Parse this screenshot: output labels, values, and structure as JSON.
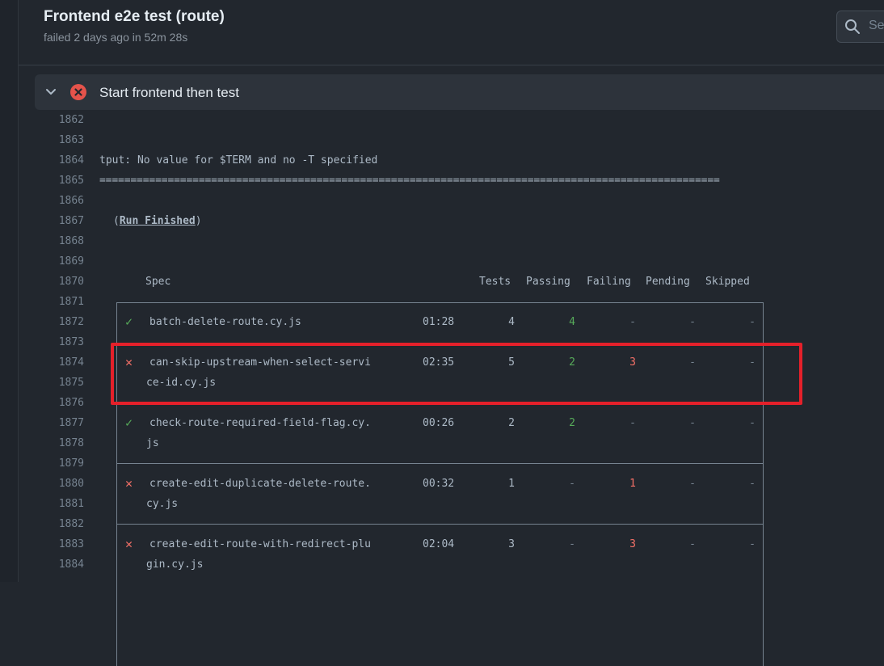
{
  "header": {
    "title": "Frontend e2e test (route)",
    "subtitle": "failed 2 days ago in 52m 28s",
    "search_placeholder": "Se"
  },
  "step": {
    "title": "Start frontend then test"
  },
  "log": {
    "line_numbers": [
      "1862",
      "1863",
      "1864",
      "1865",
      "1866",
      "1867",
      "1868",
      "1869",
      "1870",
      "1871",
      "1872",
      "1873",
      "1874",
      "1875",
      "1876",
      "1877",
      "1878",
      "1879",
      "1880",
      "1881",
      "1882",
      "1883",
      "1884"
    ],
    "tput_line": "tput: No value for $TERM and no -T specified",
    "separator": "====================================================================================================",
    "run_finished_open": "(",
    "run_finished": "Run Finished",
    "run_finished_close": ")",
    "headers": {
      "spec": "Spec",
      "tests": "Tests",
      "passing": "Passing",
      "failing": "Failing",
      "pending": "Pending",
      "skipped": "Skipped"
    },
    "rows": [
      {
        "status": "pass",
        "mark": "✓",
        "name1": "batch-delete-route.cy.js",
        "name2": "",
        "time": "01:28",
        "tests": "4",
        "passing": "4",
        "failing": "-",
        "pending": "-",
        "skipped": "-"
      },
      {
        "status": "fail",
        "mark": "✕",
        "name1": "can-skip-upstream-when-select-servi",
        "name2": "ce-id.cy.js",
        "time": "02:35",
        "tests": "5",
        "passing": "2",
        "failing": "3",
        "pending": "-",
        "skipped": "-"
      },
      {
        "status": "pass",
        "mark": "✓",
        "name1": "check-route-required-field-flag.cy.",
        "name2": "js",
        "time": "00:26",
        "tests": "2",
        "passing": "2",
        "failing": "-",
        "pending": "-",
        "skipped": "-"
      },
      {
        "status": "fail",
        "mark": "✕",
        "name1": "create-edit-duplicate-delete-route.",
        "name2": "cy.js",
        "time": "00:32",
        "tests": "1",
        "passing": "-",
        "failing": "1",
        "pending": "-",
        "skipped": "-"
      },
      {
        "status": "fail",
        "mark": "✕",
        "name1": "create-edit-route-with-redirect-plu",
        "name2": "gin.cy.js",
        "time": "02:04",
        "tests": "3",
        "passing": "-",
        "failing": "3",
        "pending": "-",
        "skipped": "-"
      }
    ]
  },
  "colors": {
    "background": "#22272e",
    "pass": "#57ab5a",
    "fail": "#f47067",
    "highlight": "#e5202a"
  }
}
